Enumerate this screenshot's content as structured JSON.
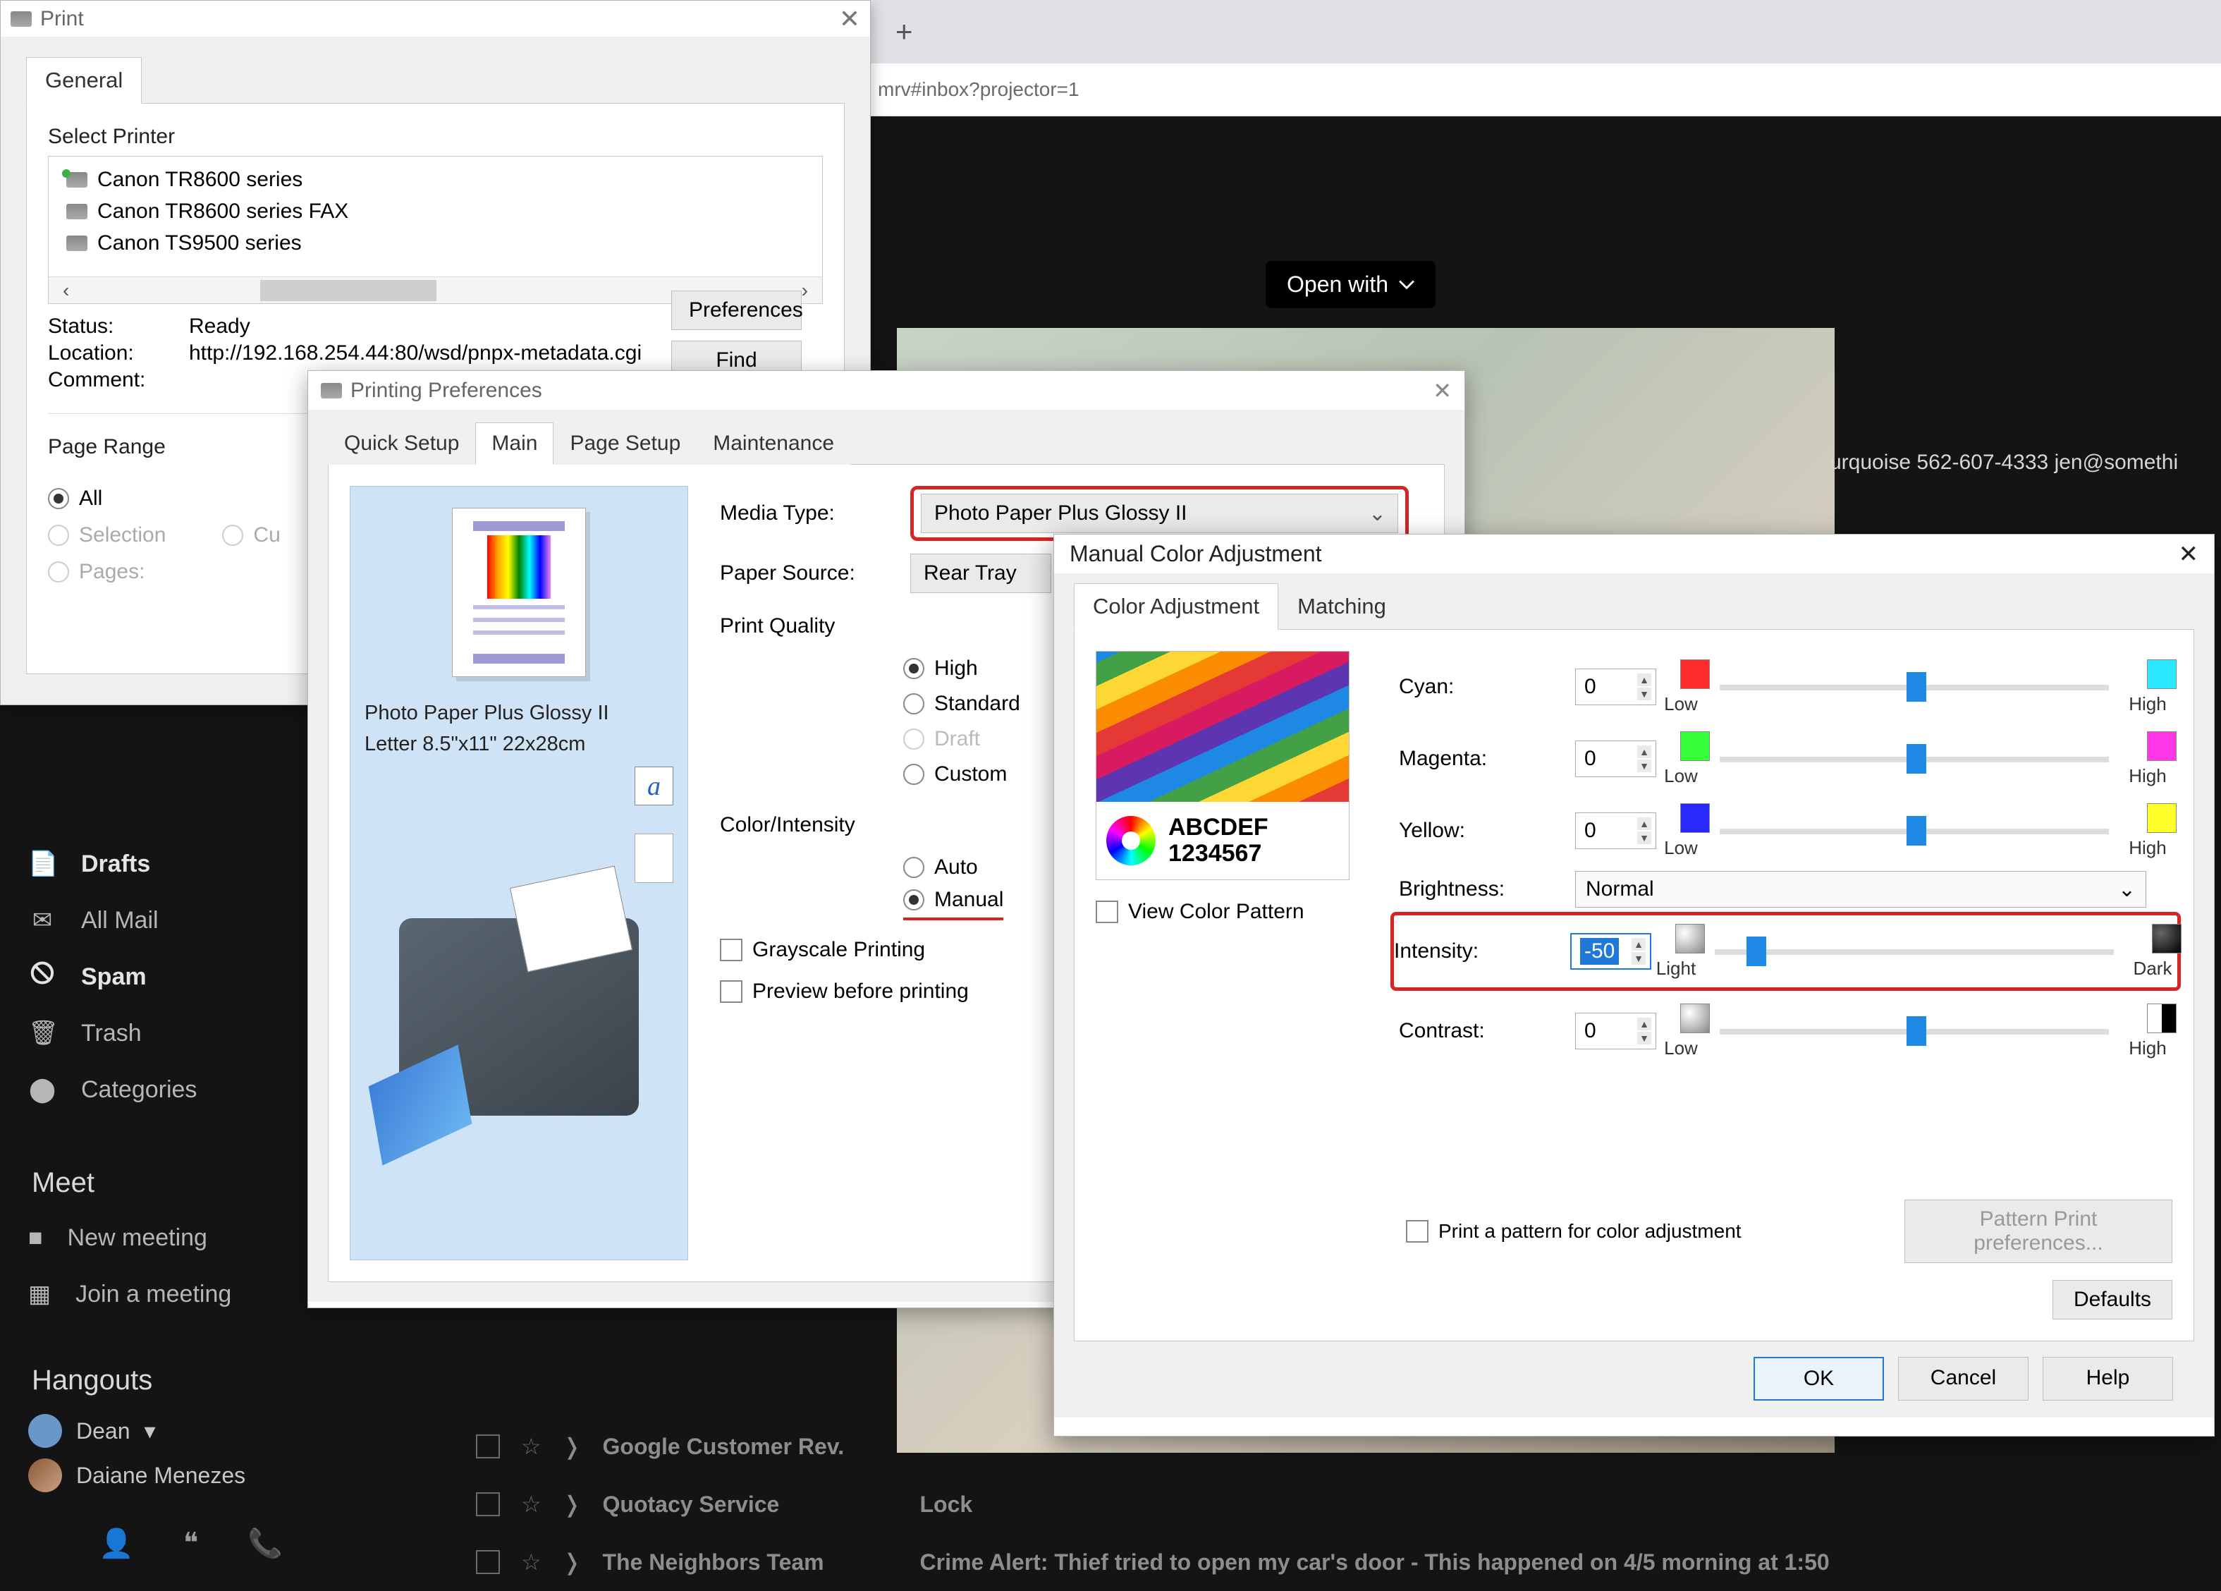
{
  "bg": {
    "plus": "+",
    "url_frag": "mrv#inbox?projector=1",
    "open_with": "Open with",
    "photo_text": "urquoise 562-607-4333 jen@somethi"
  },
  "gmail": {
    "side": [
      {
        "icon": "📄",
        "label": "Drafts",
        "bold": true
      },
      {
        "icon": "✉",
        "label": "All Mail",
        "bold": false
      },
      {
        "icon": "🛇",
        "label": "Spam",
        "bold": true
      },
      {
        "icon": "🗑",
        "label": "Trash",
        "bold": false
      },
      {
        "icon": "⬤",
        "label": "Categories",
        "bold": false
      }
    ],
    "meet_head": "Meet",
    "meet": [
      {
        "icon": "■",
        "label": "New meeting"
      },
      {
        "icon": "▦",
        "label": "Join a meeting"
      }
    ],
    "hangouts_head": "Hangouts",
    "hangouts": [
      {
        "name": "Dean",
        "caret": "▾"
      },
      {
        "name": "Daiane Menezes",
        "caret": ""
      }
    ],
    "list": [
      {
        "sender": "Google Customer Rev.",
        "subj": ""
      },
      {
        "sender": "Quotacy Service",
        "subj": "Lock "
      },
      {
        "sender": "The Neighbors Team",
        "subj": "Crime Alert: Thief tried to open my car's door - This happened on 4/5 morning at 1:50"
      }
    ]
  },
  "print": {
    "title": "Print",
    "tab_general": "General",
    "select_printer": "Select Printer",
    "printers": [
      "Canon TR8600 series",
      "Canon TR8600 series FAX",
      "Canon TS9500 series"
    ],
    "status_k": "Status:",
    "status_v": "Ready",
    "loc_k": "Location:",
    "loc_v": "http://192.168.254.44:80/wsd/pnpx-metadata.cgi",
    "comment_k": "Comment:",
    "btn_pref": "Preferences",
    "btn_find": "Find Printer...",
    "page_range": "Page Range",
    "pr_all": "All",
    "pr_sel": "Selection",
    "pr_cur": "Cu",
    "pr_pages": "Pages:"
  },
  "pref": {
    "title": "Printing Preferences",
    "tabs": [
      "Quick Setup",
      "Main",
      "Page Setup",
      "Maintenance"
    ],
    "preview_line1": "Photo Paper Plus Glossy II",
    "preview_line2": "Letter 8.5\"x11\" 22x28cm",
    "media_lbl": "Media Type:",
    "media_val": "Photo Paper Plus Glossy II",
    "source_lbl": "Paper Source:",
    "source_val": "Rear Tray",
    "quality_head": "Print Quality",
    "q_high": "High",
    "q_std": "Standard",
    "q_draft": "Draft",
    "q_custom": "Custom",
    "color_head": "Color/Intensity",
    "c_auto": "Auto",
    "c_manual": "Manual",
    "grayscale": "Grayscale Printing",
    "preview_chk": "Preview before printing"
  },
  "mca": {
    "title": "Manual Color Adjustment",
    "tabs": [
      "Color Adjustment",
      "Matching"
    ],
    "preview_txt1": "ABCDEF",
    "preview_txt2": "1234567",
    "view_pattern": "View Color Pattern",
    "sliders": {
      "cyan": {
        "label": "Cyan:",
        "val": "0",
        "low": "Low",
        "high": "High",
        "c1": "#ff2a2a",
        "c2": "#2ae8ff"
      },
      "magenta": {
        "label": "Magenta:",
        "val": "0",
        "low": "Low",
        "high": "High",
        "c1": "#37ff37",
        "c2": "#ff37e6"
      },
      "yellow": {
        "label": "Yellow:",
        "val": "0",
        "low": "Low",
        "high": "High",
        "c1": "#2a2aff",
        "c2": "#ffff2a"
      },
      "intensity": {
        "label": "Intensity:",
        "val": "-50",
        "low": "Light",
        "high": "Dark"
      },
      "contrast": {
        "label": "Contrast:",
        "val": "0",
        "low": "Low",
        "high": "High"
      }
    },
    "brightness_lbl": "Brightness:",
    "brightness_val": "Normal",
    "print_pattern": "Print a pattern for color adjustment",
    "pattern_btn": "Pattern Print preferences...",
    "defaults": "Defaults",
    "ok": "OK",
    "cancel": "Cancel",
    "help": "Help"
  }
}
